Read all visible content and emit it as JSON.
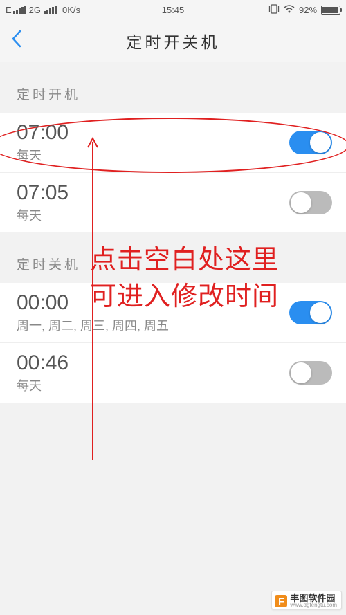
{
  "statusBar": {
    "network": "E",
    "gen": "2G",
    "speed": "0K/s",
    "time": "15:45",
    "vibrate": "⏚",
    "battery": "92%"
  },
  "navbar": {
    "title": "定时开关机"
  },
  "sections": {
    "powerOn": {
      "header": "定时开机",
      "items": [
        {
          "time": "07:00",
          "repeat": "每天",
          "enabled": true
        },
        {
          "time": "07:05",
          "repeat": "每天",
          "enabled": false
        }
      ]
    },
    "powerOff": {
      "header": "定时关机",
      "items": [
        {
          "time": "00:00",
          "repeat": "周一, 周二, 周三, 周四, 周五",
          "enabled": true
        },
        {
          "time": "00:46",
          "repeat": "每天",
          "enabled": false
        }
      ]
    }
  },
  "annotation": {
    "line1": "点击空白处这里",
    "line2": "可进入修改时间"
  },
  "watermark": {
    "logoLetter": "F",
    "logoColor": "#f08c1a",
    "name": "丰图软件园",
    "url": "www.dgfengtu.com"
  }
}
